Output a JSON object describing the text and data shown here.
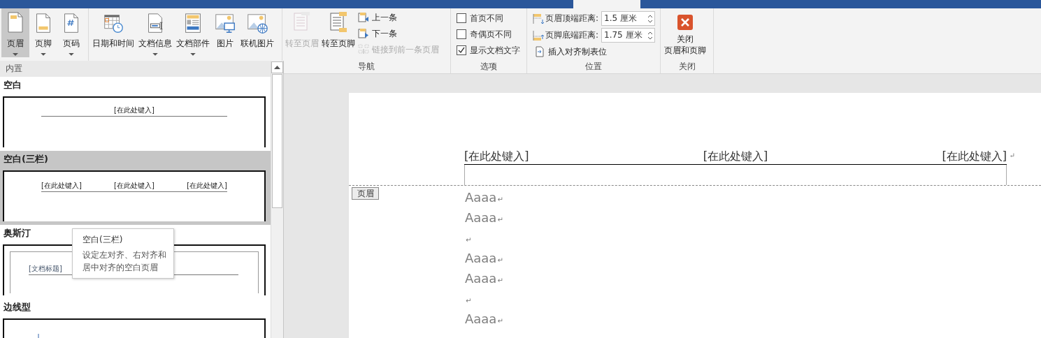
{
  "ribbon": {
    "header_footer": [
      {
        "label": "页眉",
        "kind": "header",
        "caret": true,
        "selected": true
      },
      {
        "label": "页脚",
        "kind": "footer",
        "caret": true,
        "selected": false
      },
      {
        "label": "页码",
        "kind": "pagenum",
        "caret": true,
        "selected": false
      }
    ],
    "insert": [
      {
        "label": "日期和时间",
        "kind": "calendar",
        "caret": false
      },
      {
        "label": "文档信息",
        "kind": "docinfo",
        "caret": true
      },
      {
        "label": "文档部件",
        "kind": "parts",
        "caret": true
      },
      {
        "label": "图片",
        "kind": "picture",
        "caret": false
      },
      {
        "label": "联机图片",
        "kind": "online",
        "caret": false
      }
    ],
    "navigation": {
      "label": "导航",
      "large": [
        {
          "label": "转至页眉",
          "kind": "gotoheader",
          "disabled": true
        },
        {
          "label": "转至页脚",
          "kind": "gotofooter",
          "disabled": false
        }
      ],
      "small": [
        {
          "label": "上一条",
          "kind": "prev",
          "disabled": false
        },
        {
          "label": "下一条",
          "kind": "next",
          "disabled": false
        },
        {
          "label": "链接到前一条页眉",
          "kind": "link",
          "disabled": true
        }
      ]
    },
    "options": {
      "label": "选项",
      "checkboxes": [
        {
          "label": "首页不同",
          "checked": false
        },
        {
          "label": "奇偶页不同",
          "checked": false
        },
        {
          "label": "显示文档文字",
          "checked": true
        }
      ]
    },
    "position": {
      "label": "位置",
      "spinners": [
        {
          "label": "页眉顶端距离:",
          "value": "1.5 厘米",
          "kind": "top"
        },
        {
          "label": "页脚底端距离:",
          "value": "1.75 厘米",
          "kind": "bottom"
        }
      ],
      "action": "插入对齐制表位"
    },
    "close": {
      "label": "关闭",
      "button_lines": [
        "关闭",
        "页眉和页脚"
      ]
    }
  },
  "gallery": {
    "section": "内置",
    "items": [
      {
        "name": "空白",
        "selected": false,
        "preview": {
          "kind": "center",
          "texts": [
            "[在此处键入]"
          ]
        }
      },
      {
        "name": "空白(三栏)",
        "selected": true,
        "preview": {
          "kind": "three",
          "texts": [
            "[在此处键入]",
            "[在此处键入]",
            "[在此处键入]"
          ]
        }
      },
      {
        "name": "奥斯汀",
        "selected": false,
        "preview": {
          "kind": "framed",
          "texts": [
            "[文档标题]"
          ]
        }
      },
      {
        "name": "边线型",
        "selected": false,
        "preview": {
          "kind": "sideline"
        }
      }
    ],
    "tooltip": {
      "title": "空白(三栏)",
      "description": "设定左对齐、右对齐和居中对齐的空白页眉"
    }
  },
  "document": {
    "header_texts": [
      "[在此处键入]",
      "[在此处键入]",
      "[在此处键入]"
    ],
    "header_mark": "↵",
    "header_tag": "页眉",
    "paragraphs": [
      {
        "text": "Aaaa",
        "mark": "↵"
      },
      {
        "text": "Aaaa",
        "mark": "↵"
      },
      {
        "mark": "↵"
      },
      {
        "text": "Aaaa",
        "mark": "↵"
      },
      {
        "text": "Aaaa",
        "mark": "↵"
      },
      {
        "mark": "↵"
      },
      {
        "text": "Aaaa",
        "mark": "↵"
      }
    ]
  }
}
